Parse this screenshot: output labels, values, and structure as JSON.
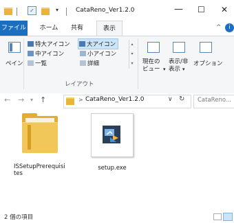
{
  "window": {
    "title": "CataReno_Ver1.2.0",
    "minimize_glyph": "—",
    "maximize_glyph": "☐",
    "close_glyph": "✕",
    "qa_dropdown_glyph": "▾"
  },
  "ribbon": {
    "tabs": [
      {
        "label": "ファイル",
        "active": false
      },
      {
        "label": "ホーム",
        "active": false
      },
      {
        "label": "共有",
        "active": false
      },
      {
        "label": "表示",
        "active": true
      }
    ],
    "collapse_glyph": "^",
    "help_glyph": "i",
    "pane_label": "ペイン",
    "layout": {
      "items": [
        "特大アイコン",
        "大アイコン",
        "中アイコン",
        "小アイコン",
        "一覧",
        "詳細"
      ],
      "selected": "大アイコン",
      "group_label": "レイアウト"
    },
    "current_view_label": "現在の\nビュー",
    "show_hide_label": "表示/非\n表示",
    "options_label": "オプション",
    "current_view_dropdown": "▾",
    "show_hide_dropdown": "▾"
  },
  "nav": {
    "back": "←",
    "forward": "→",
    "up": "↑",
    "dropdown": "▾",
    "breadcrumb_separator": ">",
    "path": "CataReno_Ver1.2.0",
    "addr_dropdown": "∨",
    "refresh": "↻",
    "search_placeholder": "CataReno..."
  },
  "files": [
    {
      "name": "ISSetupPrerequisites",
      "line1": "ISSetupPrerequisi",
      "line2": "tes",
      "type": "folder"
    },
    {
      "name": "setup.exe",
      "type": "exe"
    }
  ],
  "status": {
    "count": "2 個の項目"
  },
  "colors": {
    "accent": "#1c6fc0",
    "folder": "#f2c75a",
    "selection": "#cce4f7"
  }
}
